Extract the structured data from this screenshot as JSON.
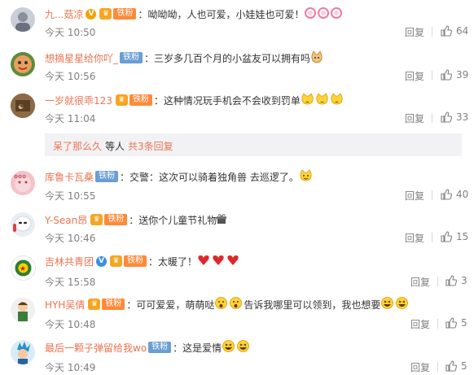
{
  "comments": [
    {
      "username": "九...菇凉",
      "text": "：呦呦呦，人也可爱，小娃娃也可爱！",
      "time": "今天 10:50",
      "reply_label": "回复",
      "likes": "64"
    },
    {
      "username": "想摘星星给你吖_",
      "text": "：三岁多几百个月的小盆友可以拥有吗",
      "time": "今天 10:56",
      "reply_label": "回复",
      "likes": "39"
    },
    {
      "username": "一岁就很乖123",
      "text": "：这种情况玩手机会不会收到罚单",
      "time": "今天 11:04",
      "reply_label": "回复",
      "likes": "33"
    },
    {
      "username": "库鲁卡瓦桑",
      "text": "：交警：这次可以骑着独角兽 去巡逻了。",
      "time": "今天 10:55",
      "reply_label": "回复",
      "likes": "40"
    },
    {
      "username": "Y-Sean昂",
      "text": "：送你个儿童节礼物",
      "time": "今天 10:46",
      "reply_label": "回复",
      "likes": "15"
    },
    {
      "username": "吉林共青团",
      "text": "：太暖了！",
      "time": "今天 15:58",
      "reply_label": "回复",
      "likes": "3"
    },
    {
      "username": "HYH吴倩",
      "text": "：可可爱爱，萌萌哒",
      "text2": "告诉我哪里可以领到，我也想要",
      "time": "今天 10:48",
      "reply_label": "回复",
      "likes": "5"
    },
    {
      "username": "最后一颗子弹留给我wo",
      "text": "：这是爱情",
      "time": "今天 10:49",
      "reply_label": "回复",
      "likes": "5"
    }
  ],
  "badges": {
    "tiefen": "铁粉"
  },
  "sub_replies": {
    "user": "呆了那么久",
    "middle": "等人",
    "link": "共3条回复"
  },
  "colors": {
    "username": "#eb7350",
    "text": "#333333",
    "meta": "#808080",
    "tiefen_blue": "#6a9ed4",
    "tiefen_orange": "#ff8a3a",
    "sub_bg": "#f2f2f5"
  },
  "icons": [
    "thumbs-up-icon",
    "v-verified-icon",
    "crown-icon",
    "lollipop-emoji",
    "cat-emoji",
    "laughing-emoji",
    "gift-emoji",
    "heart-emoji",
    "grin-emoji"
  ]
}
